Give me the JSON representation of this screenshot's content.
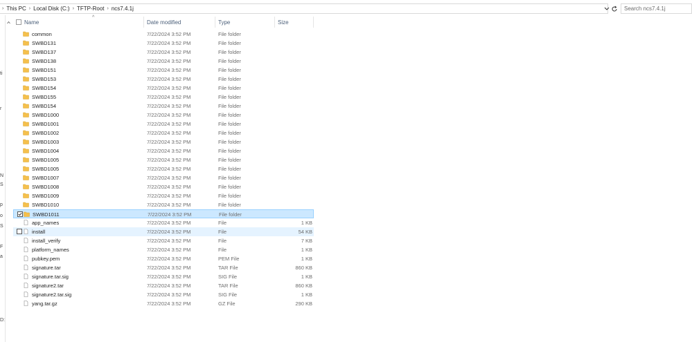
{
  "address": {
    "crumbs": [
      "This PC",
      "Local Disk (C:)",
      "TFTP-Root",
      "ncs7.4.1j"
    ],
    "search_placeholder": "Search ncs7.4.1j"
  },
  "columns": {
    "name": "Name",
    "date": "Date modified",
    "type": "Type",
    "size": "Size"
  },
  "nav_glyphs": [
    "ti",
    "r",
    "N",
    "S",
    "p",
    "o",
    "S",
    "F",
    "a",
    "D:"
  ],
  "files": [
    {
      "name": "common",
      "date": "7/22/2024 3:52 PM",
      "type": "File folder",
      "size": "",
      "kind": "folder"
    },
    {
      "name": "SWBD131",
      "date": "7/22/2024 3:52 PM",
      "type": "File folder",
      "size": "",
      "kind": "folder"
    },
    {
      "name": "SWBD137",
      "date": "7/22/2024 3:52 PM",
      "type": "File folder",
      "size": "",
      "kind": "folder"
    },
    {
      "name": "SWBD138",
      "date": "7/22/2024 3:52 PM",
      "type": "File folder",
      "size": "",
      "kind": "folder"
    },
    {
      "name": "SWBD151",
      "date": "7/22/2024 3:52 PM",
      "type": "File folder",
      "size": "",
      "kind": "folder"
    },
    {
      "name": "SWBD153",
      "date": "7/22/2024 3:52 PM",
      "type": "File folder",
      "size": "",
      "kind": "folder"
    },
    {
      "name": "SWBD154",
      "date": "7/22/2024 3:52 PM",
      "type": "File folder",
      "size": "",
      "kind": "folder"
    },
    {
      "name": "SWBD155",
      "date": "7/22/2024 3:52 PM",
      "type": "File folder",
      "size": "",
      "kind": "folder"
    },
    {
      "name": "SWBD154",
      "date": "7/22/2024 3:52 PM",
      "type": "File folder",
      "size": "",
      "kind": "folder"
    },
    {
      "name": "SWBD1000",
      "date": "7/22/2024 3:52 PM",
      "type": "File folder",
      "size": "",
      "kind": "folder"
    },
    {
      "name": "SWBD1001",
      "date": "7/22/2024 3:52 PM",
      "type": "File folder",
      "size": "",
      "kind": "folder"
    },
    {
      "name": "SWBD1002",
      "date": "7/22/2024 3:52 PM",
      "type": "File folder",
      "size": "",
      "kind": "folder"
    },
    {
      "name": "SWBD1003",
      "date": "7/22/2024 3:52 PM",
      "type": "File folder",
      "size": "",
      "kind": "folder"
    },
    {
      "name": "SWBD1004",
      "date": "7/22/2024 3:52 PM",
      "type": "File folder",
      "size": "",
      "kind": "folder"
    },
    {
      "name": "SWBD1005",
      "date": "7/22/2024 3:52 PM",
      "type": "File folder",
      "size": "",
      "kind": "folder"
    },
    {
      "name": "SWBD1005",
      "date": "7/22/2024 3:52 PM",
      "type": "File folder",
      "size": "",
      "kind": "folder"
    },
    {
      "name": "SWBD1007",
      "date": "7/22/2024 3:52 PM",
      "type": "File folder",
      "size": "",
      "kind": "folder"
    },
    {
      "name": "SWBD1008",
      "date": "7/22/2024 3:52 PM",
      "type": "File folder",
      "size": "",
      "kind": "folder"
    },
    {
      "name": "SWBD1009",
      "date": "7/22/2024 3:52 PM",
      "type": "File folder",
      "size": "",
      "kind": "folder"
    },
    {
      "name": "SWBD1010",
      "date": "7/22/2024 3:52 PM",
      "type": "File folder",
      "size": "",
      "kind": "folder"
    },
    {
      "name": "SWBD1011",
      "date": "7/22/2024 3:52 PM",
      "type": "File folder",
      "size": "",
      "kind": "folder",
      "state": "selected"
    },
    {
      "name": "app_names",
      "date": "7/22/2024 3:52 PM",
      "type": "File",
      "size": "1 KB",
      "kind": "file"
    },
    {
      "name": "install",
      "date": "7/22/2024 3:52 PM",
      "type": "File",
      "size": "54 KB",
      "kind": "file",
      "state": "hover"
    },
    {
      "name": "install_verify",
      "date": "7/22/2024 3:52 PM",
      "type": "File",
      "size": "7 KB",
      "kind": "file"
    },
    {
      "name": "platform_names",
      "date": "7/22/2024 3:52 PM",
      "type": "File",
      "size": "1 KB",
      "kind": "file"
    },
    {
      "name": "pubkey.pem",
      "date": "7/22/2024 3:52 PM",
      "type": "PEM File",
      "size": "1 KB",
      "kind": "file"
    },
    {
      "name": "signature.tar",
      "date": "7/22/2024 3:52 PM",
      "type": "TAR File",
      "size": "860 KB",
      "kind": "file"
    },
    {
      "name": "signature.tar.sig",
      "date": "7/22/2024 3:52 PM",
      "type": "SIG File",
      "size": "1 KB",
      "kind": "file"
    },
    {
      "name": "signature2.tar",
      "date": "7/22/2024 3:52 PM",
      "type": "TAR File",
      "size": "860 KB",
      "kind": "file"
    },
    {
      "name": "signature2.tar.sig",
      "date": "7/22/2024 3:52 PM",
      "type": "SIG File",
      "size": "1 KB",
      "kind": "file"
    },
    {
      "name": "yang.tar.gz",
      "date": "7/22/2024 3:52 PM",
      "type": "GZ File",
      "size": "290 KB",
      "kind": "file"
    }
  ],
  "colors": {
    "folder": "#f5c04d",
    "selected_bg": "#cce8ff",
    "hover_bg": "#e5f3ff"
  }
}
